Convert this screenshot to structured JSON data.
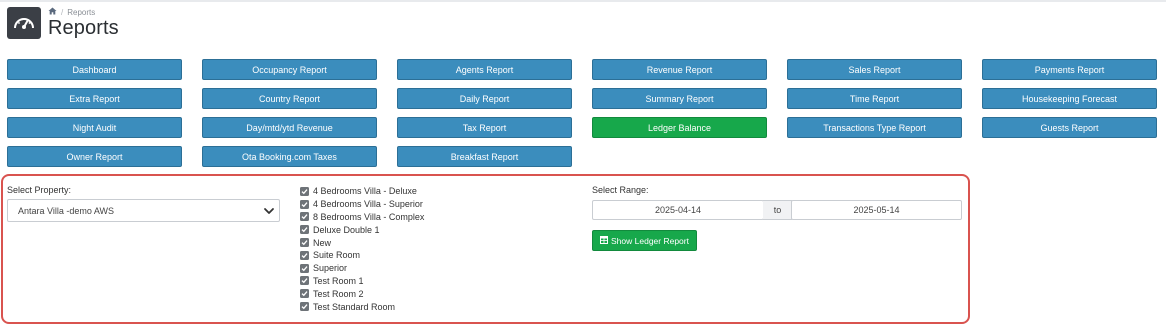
{
  "breadcrumb": {
    "current": "Reports"
  },
  "page": {
    "title": "Reports"
  },
  "report_buttons": [
    "Dashboard",
    "Occupancy Report",
    "Agents Report",
    "Revenue Report",
    "Sales Report",
    "Payments Report",
    "Extra Report",
    "Country Report",
    "Daily Report",
    "Summary Report",
    "Time Report",
    "Housekeeping Forecast",
    "Night Audit",
    "Day/mtd/ytd Revenue",
    "Tax Report",
    "Ledger Balance",
    "Transactions Type Report",
    "Guests Report",
    "Owner Report",
    "Ota Booking.com Taxes",
    "Breakfast Report"
  ],
  "active_report": "Ledger Balance",
  "filters": {
    "property_label": "Select Property:",
    "property_value": "Antara Villa -demo AWS",
    "rooms": [
      "4 Bedrooms Villa - Deluxe",
      "4 Bedrooms Villa - Superior",
      "8 Bedrooms Villa - Complex",
      "Deluxe Double 1",
      "New",
      "Suite Room",
      "Superior",
      "Test Room 1",
      "Test Room 2",
      "Test Standard Room"
    ],
    "range_label": "Select Range:",
    "date_from": "2025-04-14",
    "to_label": "to",
    "date_to": "2025-05-14",
    "show_button_label": "Show Ledger Report"
  },
  "colors": {
    "primary": "#3b8dbd",
    "success": "#17a84b",
    "highlight_border": "#d9534f"
  }
}
